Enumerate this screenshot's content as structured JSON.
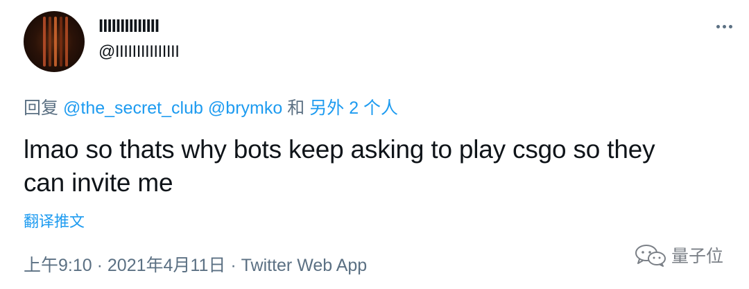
{
  "tweet": {
    "author": {
      "display_name": "IIIIIIIIIIIIII",
      "handle": "@IIIIIIIIIIIIIII"
    },
    "more_icon": "more-horizontal-icon",
    "reply": {
      "prefix": "回复",
      "mention_1": "@the_secret_club",
      "mention_2": "@brymko",
      "conjunction": "和",
      "others": "另外 2 个人"
    },
    "text_line_1": "lmao so thats why bots keep asking to play csgo so they",
    "text_line_2": "can invite me",
    "translate_label": "翻译推文",
    "meta": {
      "time": "上午9:10",
      "separator_1": "·",
      "date": "2021年4月11日",
      "separator_2": "·",
      "source": "Twitter Web App"
    }
  },
  "watermark": {
    "logo_icon": "wechat-icon",
    "text": "量子位"
  },
  "colors": {
    "link": "#1d9bf0",
    "secondary_text": "#5b7083",
    "primary_text": "#0f1419"
  }
}
